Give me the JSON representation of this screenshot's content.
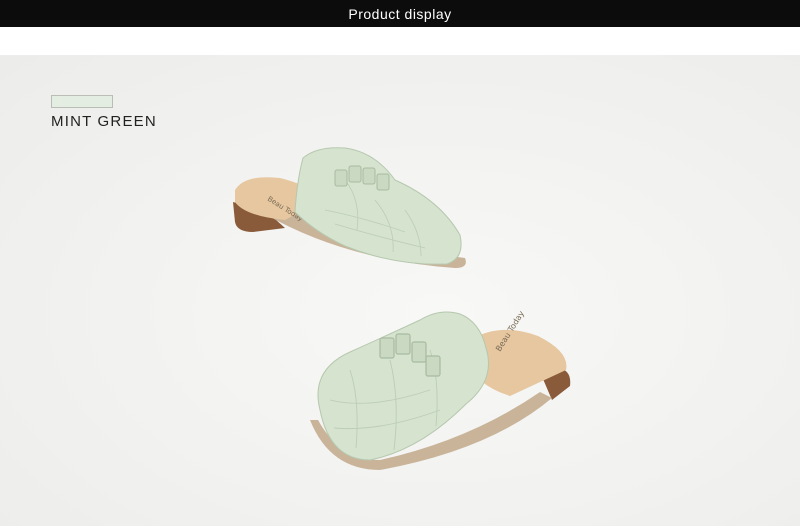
{
  "header": {
    "title": "Product display"
  },
  "swatch": {
    "color_name": "MINT GREEN",
    "color": "#e3ede1"
  },
  "colors": {
    "upper": "#d5e3cf",
    "upper_shadow": "#b6c8ae",
    "insole": "#e6c7a0",
    "sole": "#8a5b3a",
    "background": "#f3f3f1"
  },
  "product": {
    "insole_brand_text": "Beau Today"
  }
}
